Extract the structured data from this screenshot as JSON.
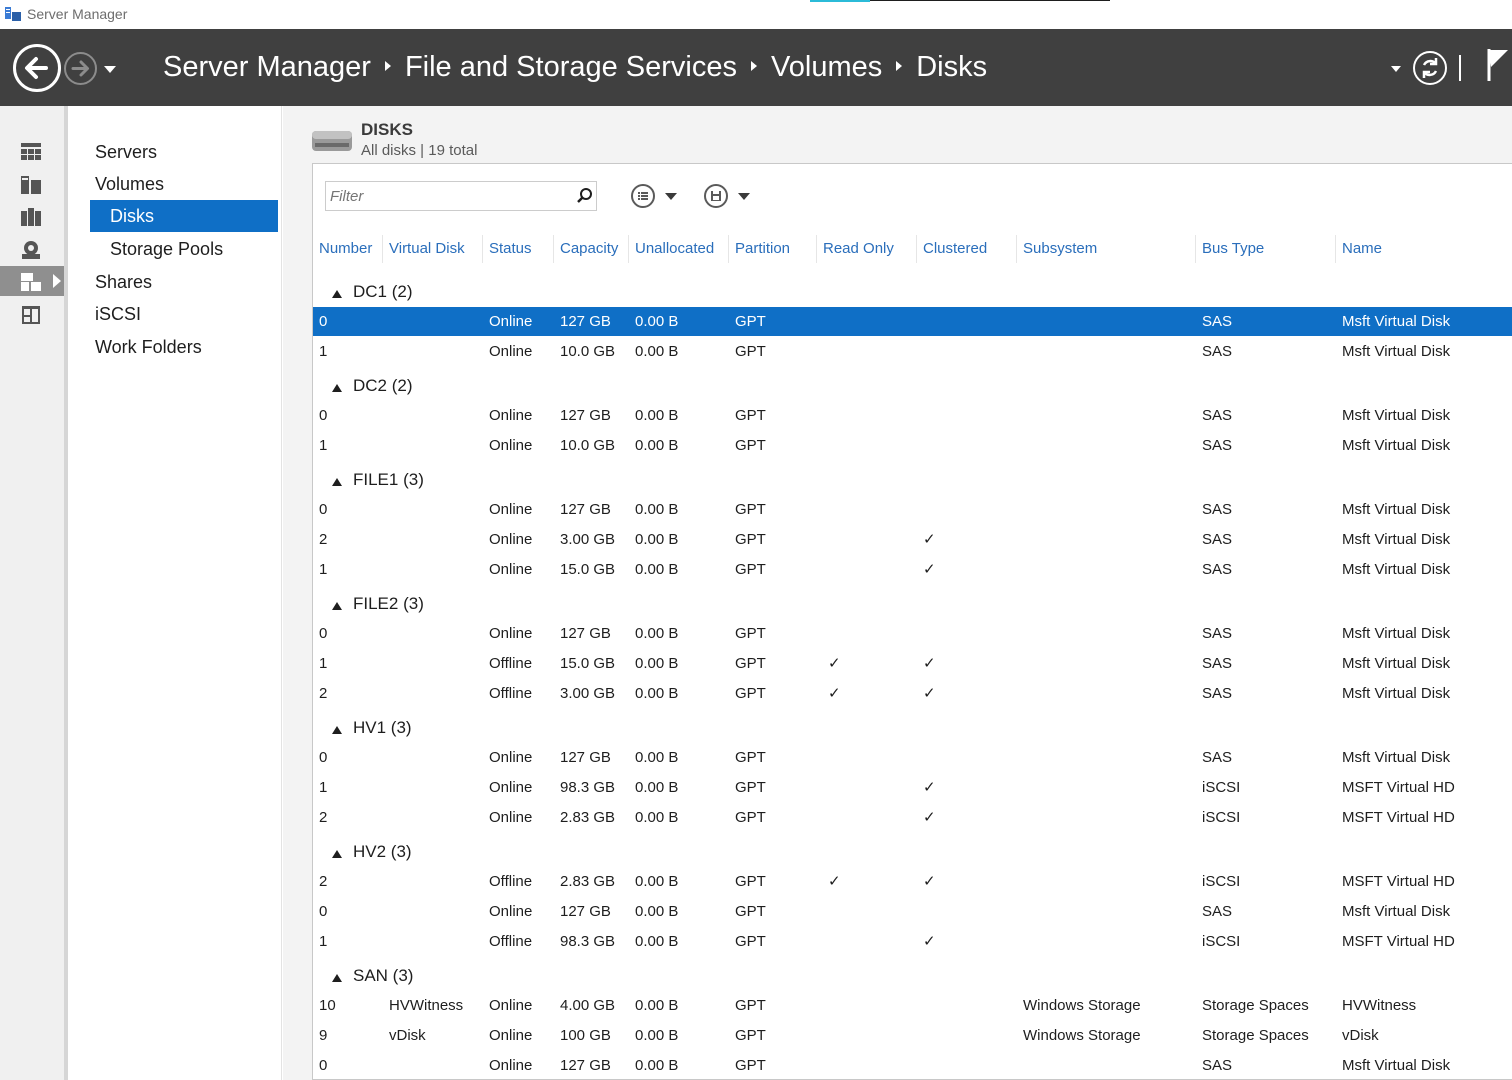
{
  "window": {
    "title": "Server Manager"
  },
  "header": {
    "breadcrumb": [
      "Server Manager",
      "File and Storage Services",
      "Volumes",
      "Disks"
    ]
  },
  "icons": {
    "back": "back-arrow-icon",
    "forward": "forward-arrow-icon",
    "refresh": "refresh-icon",
    "flag": "notification-flag-icon"
  },
  "rail": [
    "dashboard",
    "local-server",
    "all-servers",
    "storage-services",
    "file-and-storage-services",
    "iis"
  ],
  "nav": {
    "items": [
      "Servers",
      "Volumes",
      "Disks",
      "Storage Pools",
      "Shares",
      "iSCSI",
      "Work Folders"
    ],
    "selected": "Disks"
  },
  "section": {
    "title": "DISKS",
    "subtitle": "All disks | 19 total"
  },
  "filter": {
    "placeholder": "Filter"
  },
  "table": {
    "columns": [
      "Number",
      "Virtual Disk",
      "Status",
      "Capacity",
      "Unallocated",
      "Partition",
      "Read Only",
      "Clustered",
      "Subsystem",
      "Bus Type",
      "Name"
    ],
    "check_mark": "✓",
    "groups": [
      {
        "label": "DC1 (2)",
        "rows": [
          {
            "number": "0",
            "virtual_disk": "",
            "status": "Online",
            "capacity": "127 GB",
            "unallocated": "0.00 B",
            "partition": "GPT",
            "read_only": false,
            "clustered": false,
            "subsystem": "",
            "bus_type": "SAS",
            "name": "Msft Virtual Disk",
            "selected": true
          },
          {
            "number": "1",
            "virtual_disk": "",
            "status": "Online",
            "capacity": "10.0 GB",
            "unallocated": "0.00 B",
            "partition": "GPT",
            "read_only": false,
            "clustered": false,
            "subsystem": "",
            "bus_type": "SAS",
            "name": "Msft Virtual Disk"
          }
        ]
      },
      {
        "label": "DC2 (2)",
        "rows": [
          {
            "number": "0",
            "virtual_disk": "",
            "status": "Online",
            "capacity": "127 GB",
            "unallocated": "0.00 B",
            "partition": "GPT",
            "read_only": false,
            "clustered": false,
            "subsystem": "",
            "bus_type": "SAS",
            "name": "Msft Virtual Disk"
          },
          {
            "number": "1",
            "virtual_disk": "",
            "status": "Online",
            "capacity": "10.0 GB",
            "unallocated": "0.00 B",
            "partition": "GPT",
            "read_only": false,
            "clustered": false,
            "subsystem": "",
            "bus_type": "SAS",
            "name": "Msft Virtual Disk"
          }
        ]
      },
      {
        "label": "FILE1 (3)",
        "rows": [
          {
            "number": "0",
            "virtual_disk": "",
            "status": "Online",
            "capacity": "127 GB",
            "unallocated": "0.00 B",
            "partition": "GPT",
            "read_only": false,
            "clustered": false,
            "subsystem": "",
            "bus_type": "SAS",
            "name": "Msft Virtual Disk"
          },
          {
            "number": "2",
            "virtual_disk": "",
            "status": "Online",
            "capacity": "3.00 GB",
            "unallocated": "0.00 B",
            "partition": "GPT",
            "read_only": false,
            "clustered": true,
            "subsystem": "",
            "bus_type": "SAS",
            "name": "Msft Virtual Disk"
          },
          {
            "number": "1",
            "virtual_disk": "",
            "status": "Online",
            "capacity": "15.0 GB",
            "unallocated": "0.00 B",
            "partition": "GPT",
            "read_only": false,
            "clustered": true,
            "subsystem": "",
            "bus_type": "SAS",
            "name": "Msft Virtual Disk"
          }
        ]
      },
      {
        "label": "FILE2 (3)",
        "rows": [
          {
            "number": "0",
            "virtual_disk": "",
            "status": "Online",
            "capacity": "127 GB",
            "unallocated": "0.00 B",
            "partition": "GPT",
            "read_only": false,
            "clustered": false,
            "subsystem": "",
            "bus_type": "SAS",
            "name": "Msft Virtual Disk"
          },
          {
            "number": "1",
            "virtual_disk": "",
            "status": "Offline",
            "capacity": "15.0 GB",
            "unallocated": "0.00 B",
            "partition": "GPT",
            "read_only": true,
            "clustered": true,
            "subsystem": "",
            "bus_type": "SAS",
            "name": "Msft Virtual Disk"
          },
          {
            "number": "2",
            "virtual_disk": "",
            "status": "Offline",
            "capacity": "3.00 GB",
            "unallocated": "0.00 B",
            "partition": "GPT",
            "read_only": true,
            "clustered": true,
            "subsystem": "",
            "bus_type": "SAS",
            "name": "Msft Virtual Disk"
          }
        ]
      },
      {
        "label": "HV1 (3)",
        "rows": [
          {
            "number": "0",
            "virtual_disk": "",
            "status": "Online",
            "capacity": "127 GB",
            "unallocated": "0.00 B",
            "partition": "GPT",
            "read_only": false,
            "clustered": false,
            "subsystem": "",
            "bus_type": "SAS",
            "name": "Msft Virtual Disk"
          },
          {
            "number": "1",
            "virtual_disk": "",
            "status": "Online",
            "capacity": "98.3 GB",
            "unallocated": "0.00 B",
            "partition": "GPT",
            "read_only": false,
            "clustered": true,
            "subsystem": "",
            "bus_type": "iSCSI",
            "name": "MSFT Virtual HD"
          },
          {
            "number": "2",
            "virtual_disk": "",
            "status": "Online",
            "capacity": "2.83 GB",
            "unallocated": "0.00 B",
            "partition": "GPT",
            "read_only": false,
            "clustered": true,
            "subsystem": "",
            "bus_type": "iSCSI",
            "name": "MSFT Virtual HD"
          }
        ]
      },
      {
        "label": "HV2 (3)",
        "rows": [
          {
            "number": "2",
            "virtual_disk": "",
            "status": "Offline",
            "capacity": "2.83 GB",
            "unallocated": "0.00 B",
            "partition": "GPT",
            "read_only": true,
            "clustered": true,
            "subsystem": "",
            "bus_type": "iSCSI",
            "name": "MSFT Virtual HD"
          },
          {
            "number": "0",
            "virtual_disk": "",
            "status": "Online",
            "capacity": "127 GB",
            "unallocated": "0.00 B",
            "partition": "GPT",
            "read_only": false,
            "clustered": false,
            "subsystem": "",
            "bus_type": "SAS",
            "name": "Msft Virtual Disk"
          },
          {
            "number": "1",
            "virtual_disk": "",
            "status": "Offline",
            "capacity": "98.3 GB",
            "unallocated": "0.00 B",
            "partition": "GPT",
            "read_only": false,
            "clustered": true,
            "subsystem": "",
            "bus_type": "iSCSI",
            "name": "MSFT Virtual HD"
          }
        ]
      },
      {
        "label": "SAN (3)",
        "rows": [
          {
            "number": "10",
            "virtual_disk": "HVWitness",
            "status": "Online",
            "capacity": "4.00 GB",
            "unallocated": "0.00 B",
            "partition": "GPT",
            "read_only": false,
            "clustered": false,
            "subsystem": "Windows Storage",
            "bus_type": "Storage Spaces",
            "name": "HVWitness"
          },
          {
            "number": "9",
            "virtual_disk": "vDisk",
            "status": "Online",
            "capacity": "100 GB",
            "unallocated": "0.00 B",
            "partition": "GPT",
            "read_only": false,
            "clustered": false,
            "subsystem": "Windows Storage",
            "bus_type": "Storage Spaces",
            "name": "vDisk"
          },
          {
            "number": "0",
            "virtual_disk": "",
            "status": "Online",
            "capacity": "127 GB",
            "unallocated": "0.00 B",
            "partition": "GPT",
            "read_only": false,
            "clustered": false,
            "subsystem": "",
            "bus_type": "SAS",
            "name": "Msft Virtual Disk"
          }
        ]
      }
    ]
  },
  "colors": {
    "header_bg": "#404040",
    "selection": "#0f6fc6",
    "column_header_text": "#2a6ebb",
    "content_bg": "#f3f3f3"
  }
}
